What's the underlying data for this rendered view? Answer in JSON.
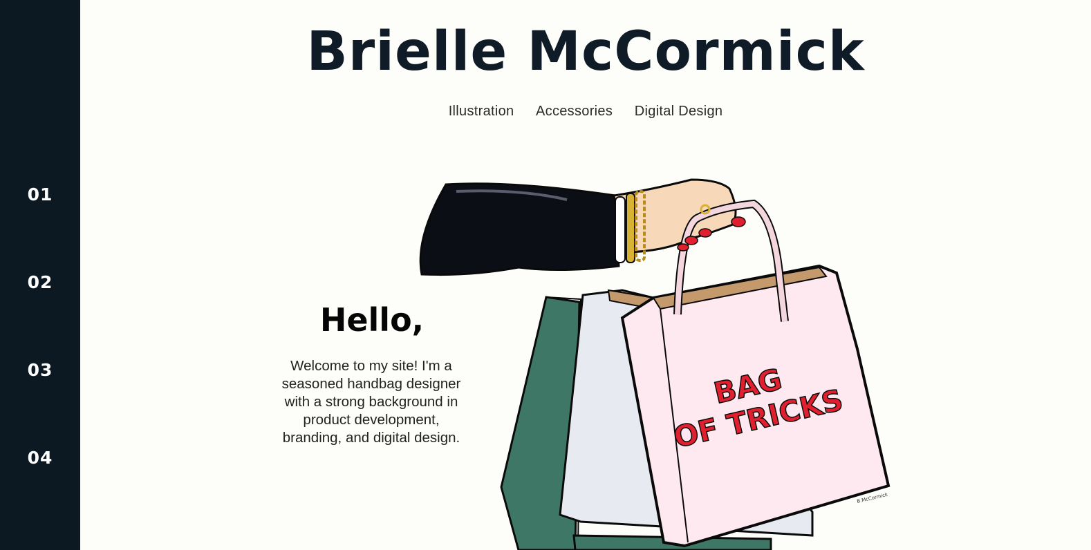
{
  "sidebar": {
    "items": [
      {
        "label": "01"
      },
      {
        "label": "02"
      },
      {
        "label": "03"
      },
      {
        "label": "04"
      }
    ]
  },
  "header": {
    "title": "Brielle McCormick"
  },
  "nav": {
    "items": [
      {
        "label": "Illustration"
      },
      {
        "label": "Accessories"
      },
      {
        "label": "Digital Design"
      }
    ]
  },
  "hero": {
    "greeting": "Hello,",
    "intro_lines": [
      "Welcome to my site! I'm a",
      "seasoned handbag designer",
      "with a strong background in",
      "product development,",
      "branding, and digital design."
    ],
    "illustration": {
      "bag_text_line1": "BAG",
      "bag_text_line2": "OF TRICKS",
      "signature": "B.McCormick"
    }
  },
  "colors": {
    "sidebar_bg": "#0c1923",
    "page_bg": "#fdfdfa",
    "title": "#0f1b26",
    "bag_text_red": "#e0202e",
    "bag_pink": "#fde9ef",
    "bag_green": "#3f7766"
  }
}
